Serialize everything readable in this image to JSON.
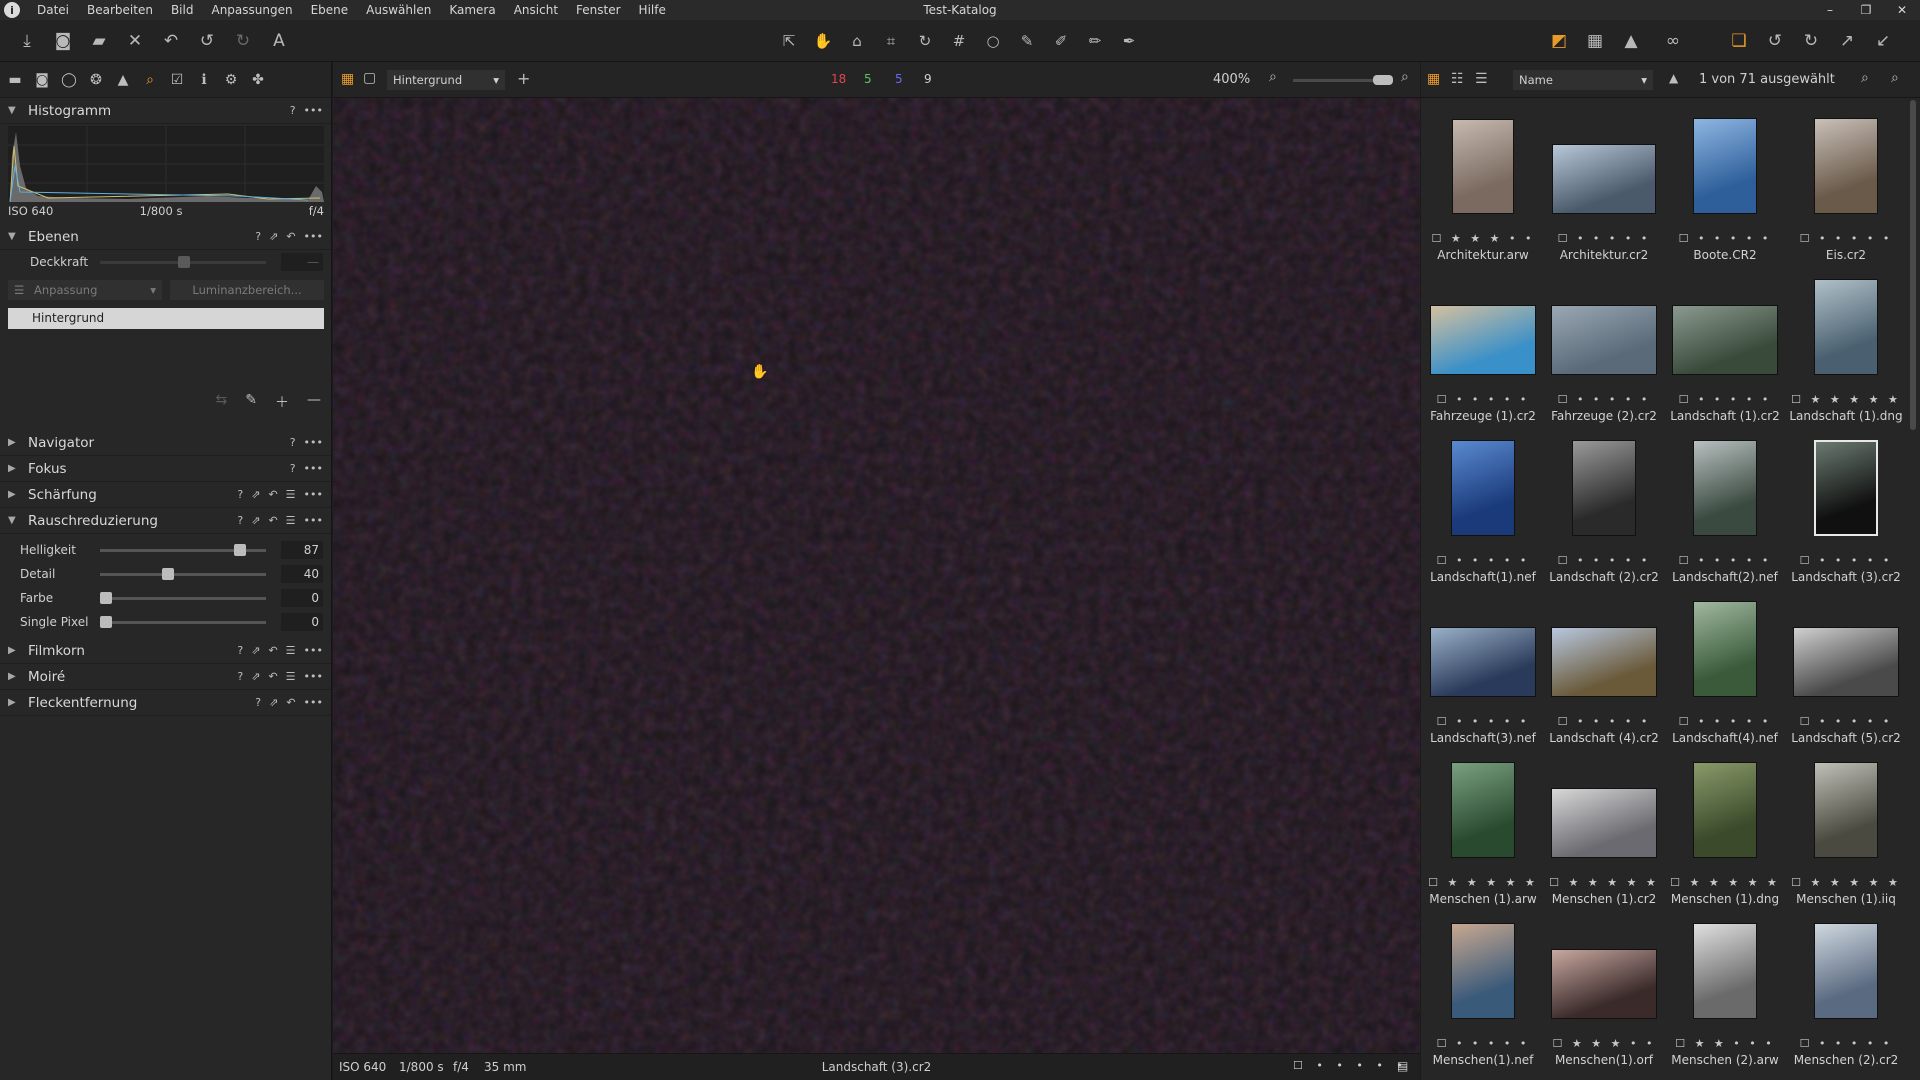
{
  "app": {
    "title": "Test-Katalog",
    "menu": [
      "Datei",
      "Bearbeiten",
      "Bild",
      "Anpassungen",
      "Ebene",
      "Auswählen",
      "Kamera",
      "Ansicht",
      "Fenster",
      "Hilfe"
    ]
  },
  "left": {
    "histogram": {
      "title": "Histogramm",
      "iso": "ISO 640",
      "shutter": "1/800 s",
      "aperture": "f/4"
    },
    "layers": {
      "title": "Ebenen",
      "opacity_label": "Deckkraft",
      "opacity_value": "—",
      "adjust_dropdown": "Anpassung",
      "luminance_button": "Luminanzbereich...",
      "active_layer": "Hintergrund"
    },
    "sections": {
      "navigator": "Navigator",
      "focus": "Fokus",
      "sharpening": "Schärfung",
      "noise": "Rauschreduzierung",
      "grain": "Filmkorn",
      "moire": "Moiré",
      "spot": "Fleckentfernung"
    },
    "noise_sliders": [
      {
        "label": "Helligkeit",
        "value": "87",
        "level": 0.87
      },
      {
        "label": "Detail",
        "value": "40",
        "level": 0.4
      },
      {
        "label": "Farbe",
        "value": "0",
        "level": 0
      },
      {
        "label": "Single Pixel",
        "value": "0",
        "level": 0
      }
    ]
  },
  "viewer": {
    "layer_dropdown": "Hintergrund",
    "count_red": "18",
    "count_green": "5",
    "count_blue": "5",
    "count_total": "9",
    "zoom": "400%",
    "status": {
      "iso": "ISO 640",
      "shutter": "1/800 s",
      "aperture": "f/4",
      "focal": "35 mm",
      "filename": "Landschaft (3).cr2"
    }
  },
  "browser": {
    "sort": "Name",
    "selection": "1 von 71 ausgewählt",
    "thumbs": [
      {
        "name": "Architektur.arw",
        "rating": "☐ ★ ★ ★ • •",
        "w": 62,
        "h": 95,
        "c1": "#7a6a60",
        "c2": "#c7b9b0"
      },
      {
        "name": "Architektur.cr2",
        "rating": "☐ • • • • •",
        "w": 104,
        "h": 70,
        "c1": "#4a5a6a",
        "c2": "#b8c8d8"
      },
      {
        "name": "Boote.CR2",
        "rating": "☐ • • • • •",
        "w": 64,
        "h": 96,
        "c1": "#2e5f9a",
        "c2": "#8eb6e2"
      },
      {
        "name": "Eis.cr2",
        "rating": "☐ • • • • •",
        "w": 64,
        "h": 96,
        "c1": "#6a5a4a",
        "c2": "#c9c0b8"
      },
      {
        "name": "Fahrzeuge (1).cr2",
        "rating": "☐ • • • • •",
        "w": 106,
        "h": 70,
        "c1": "#3a90c8",
        "c2": "#d4c0a0"
      },
      {
        "name": "Fahrzeuge (2).cr2",
        "rating": "☐ • • • • •",
        "w": 106,
        "h": 70,
        "c1": "#5a6a78",
        "c2": "#9aa8b4"
      },
      {
        "name": "Landschaft (1).cr2",
        "rating": "☐ • • • • •",
        "w": 106,
        "h": 70,
        "c1": "#3a4a3a",
        "c2": "#8a9a90"
      },
      {
        "name": "Landschaft (1).dng",
        "rating": "☐ ★ ★ ★ ★ ★",
        "w": 64,
        "h": 96,
        "c1": "#4a6070",
        "c2": "#b0c0c8"
      },
      {
        "name": "Landschaft(1).nef",
        "rating": "☐ • • • • •",
        "w": 64,
        "h": 96,
        "c1": "#1a3a7a",
        "c2": "#5a8ad0"
      },
      {
        "name": "Landschaft (2).cr2",
        "rating": "☐ • • • • •",
        "w": 64,
        "h": 96,
        "c1": "#2a2a2a",
        "c2": "#9a9a9a"
      },
      {
        "name": "Landschaft(2).nef",
        "rating": "☐ • • • • •",
        "w": 64,
        "h": 96,
        "c1": "#3a4a40",
        "c2": "#b8c0c0"
      },
      {
        "name": "Landschaft (3).cr2",
        "rating": "☐ • • • • •",
        "w": 64,
        "h": 96,
        "c1": "#101010",
        "c2": "#6a7a70",
        "selected": true
      },
      {
        "name": "Landschaft(3).nef",
        "rating": "☐ • • • • •",
        "w": 106,
        "h": 70,
        "c1": "#2a3a5a",
        "c2": "#9ab0c8"
      },
      {
        "name": "Landschaft (4).cr2",
        "rating": "☐ • • • • •",
        "w": 106,
        "h": 70,
        "c1": "#6a5a3a",
        "c2": "#b8c8e0"
      },
      {
        "name": "Landschaft(4).nef",
        "rating": "☐ • • • • •",
        "w": 64,
        "h": 96,
        "c1": "#3a5a3a",
        "c2": "#a0b8a0"
      },
      {
        "name": "Landschaft (5).cr2",
        "rating": "☐ • • • • •",
        "w": 106,
        "h": 70,
        "c1": "#4a4a4a",
        "c2": "#d0d0d0"
      },
      {
        "name": "Menschen (1).arw",
        "rating": "☐ ★ ★ ★ ★ ★",
        "w": 64,
        "h": 96,
        "c1": "#2a4a30",
        "c2": "#7aa080"
      },
      {
        "name": "Menschen (1).cr2",
        "rating": "☐ ★ ★ ★ ★ ★",
        "w": 106,
        "h": 70,
        "c1": "#6a6a70",
        "c2": "#d8d8d8"
      },
      {
        "name": "Menschen (1).dng",
        "rating": "☐ ★ ★ ★ ★ ★",
        "w": 64,
        "h": 96,
        "c1": "#3a4a2a",
        "c2": "#8a9a6a"
      },
      {
        "name": "Menschen (1).iiq",
        "rating": "☐ ★ ★ ★ ★ ★",
        "w": 64,
        "h": 96,
        "c1": "#4a4a40",
        "c2": "#c0c0b8"
      },
      {
        "name": "Menschen(1).nef",
        "rating": "☐ • • • • •",
        "w": 64,
        "h": 96,
        "c1": "#3a5a7a",
        "c2": "#c8a890"
      },
      {
        "name": "Menschen(1).orf",
        "rating": "☐ ★ ★ ★ • •",
        "w": 106,
        "h": 70,
        "c1": "#3a2a2a",
        "c2": "#c8a8a0"
      },
      {
        "name": "Menschen (2).arw",
        "rating": "☐ ★ ★ • • •",
        "w": 64,
        "h": 96,
        "c1": "#6a6a6a",
        "c2": "#e0e0e0"
      },
      {
        "name": "Menschen (2).cr2",
        "rating": "☐ • • • • •",
        "w": 64,
        "h": 96,
        "c1": "#5a6a80",
        "c2": "#d0d8e0"
      }
    ]
  },
  "colors": {
    "accent": "#e89a2a",
    "red": "#e0474c",
    "green": "#5fc55f",
    "blue": "#6a6af0"
  }
}
